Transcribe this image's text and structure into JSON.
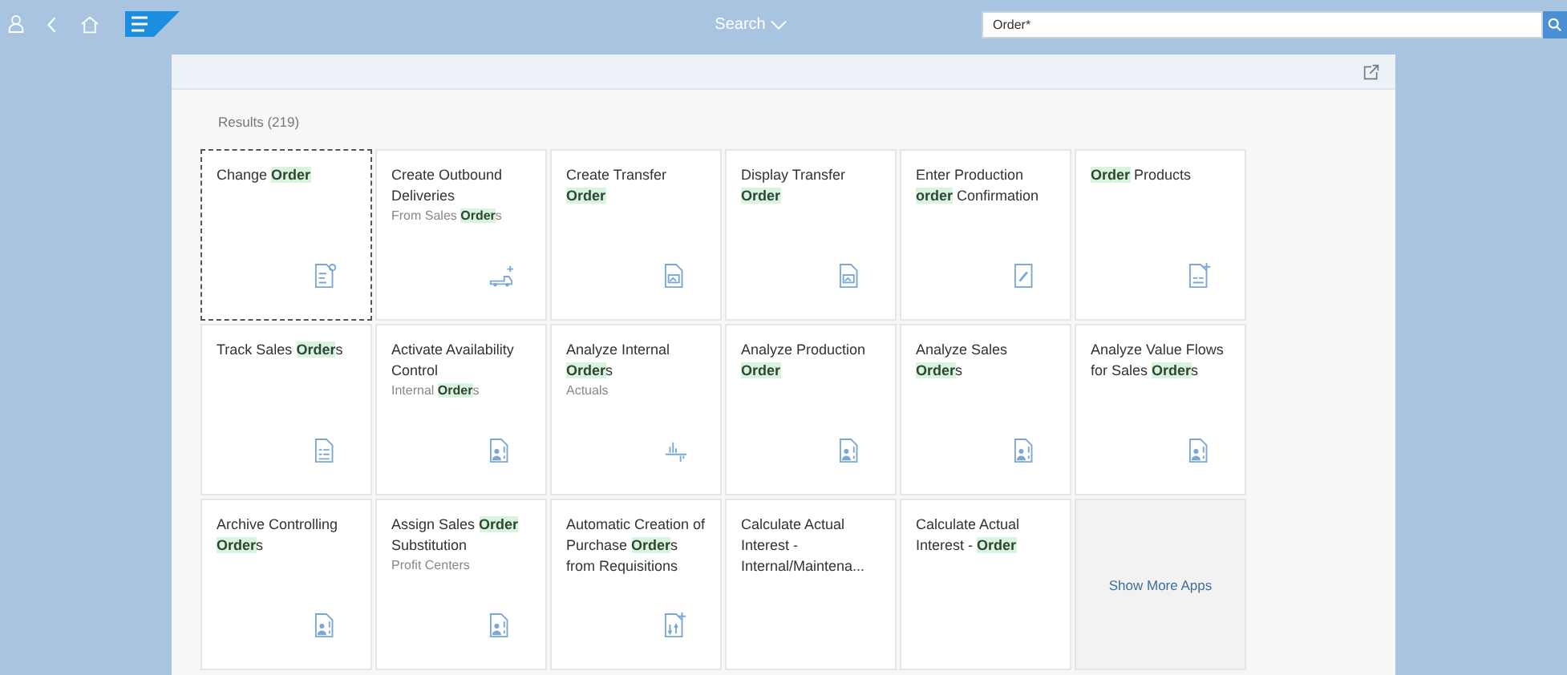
{
  "shell_bar": {
    "search_scope": "Search",
    "search": {
      "value": "Order*"
    }
  },
  "results": {
    "title": "Results (219)",
    "tiles": [
      {
        "title": "Change **Order**",
        "kind": "doc-search",
        "focused": true
      },
      {
        "title": "Create Outbound Deliveries",
        "subtitle": "From Sales **Order**s",
        "kind": "truck",
        "focused": false
      },
      {
        "title": "Create Transfer **Order**",
        "kind": "doc-image",
        "focused": false
      },
      {
        "title": "Display Transfer **Order**",
        "kind": "doc-image",
        "focused": false
      },
      {
        "title": "Enter Production **order** Confirmation",
        "kind": "doc-edit",
        "focused": false
      },
      {
        "title": "**Order** Products",
        "kind": "doc-add",
        "focused": false
      },
      {
        "title": "Track Sales **Order**s",
        "kind": "doc-list",
        "focused": false
      },
      {
        "title": "Activate Availability Control",
        "subtitle": "Internal **Order**s",
        "kind": "doc-person",
        "focused": false
      },
      {
        "title": "Analyze Internal **Order**s",
        "subtitle": "Actuals",
        "kind": "chart",
        "focused": false
      },
      {
        "title": "Analyze Production **Order**",
        "kind": "doc-person",
        "focused": false
      },
      {
        "title": "Analyze Sales **Order**s",
        "kind": "doc-person",
        "focused": false
      },
      {
        "title": "Analyze Value Flows for Sales **Order**s",
        "kind": "doc-person",
        "focused": false
      },
      {
        "title": "Archive Controlling **Order**s",
        "kind": "doc-person",
        "focused": false
      },
      {
        "title": "Assign Sales **Order** Substitution",
        "subtitle": "Profit Centers",
        "kind": "doc-person",
        "focused": false
      },
      {
        "title": "Automatic Creation of Purchase **Order**s from Requisitions",
        "kind": "doc-sort",
        "focused": false
      },
      {
        "title": "Calculate Actual Interest - Internal/Maintena...",
        "kind": "plain",
        "focused": false
      },
      {
        "title": "Calculate Actual Interest - **Order**",
        "kind": "plain",
        "focused": false
      }
    ],
    "show_more": "Show More Apps"
  }
}
